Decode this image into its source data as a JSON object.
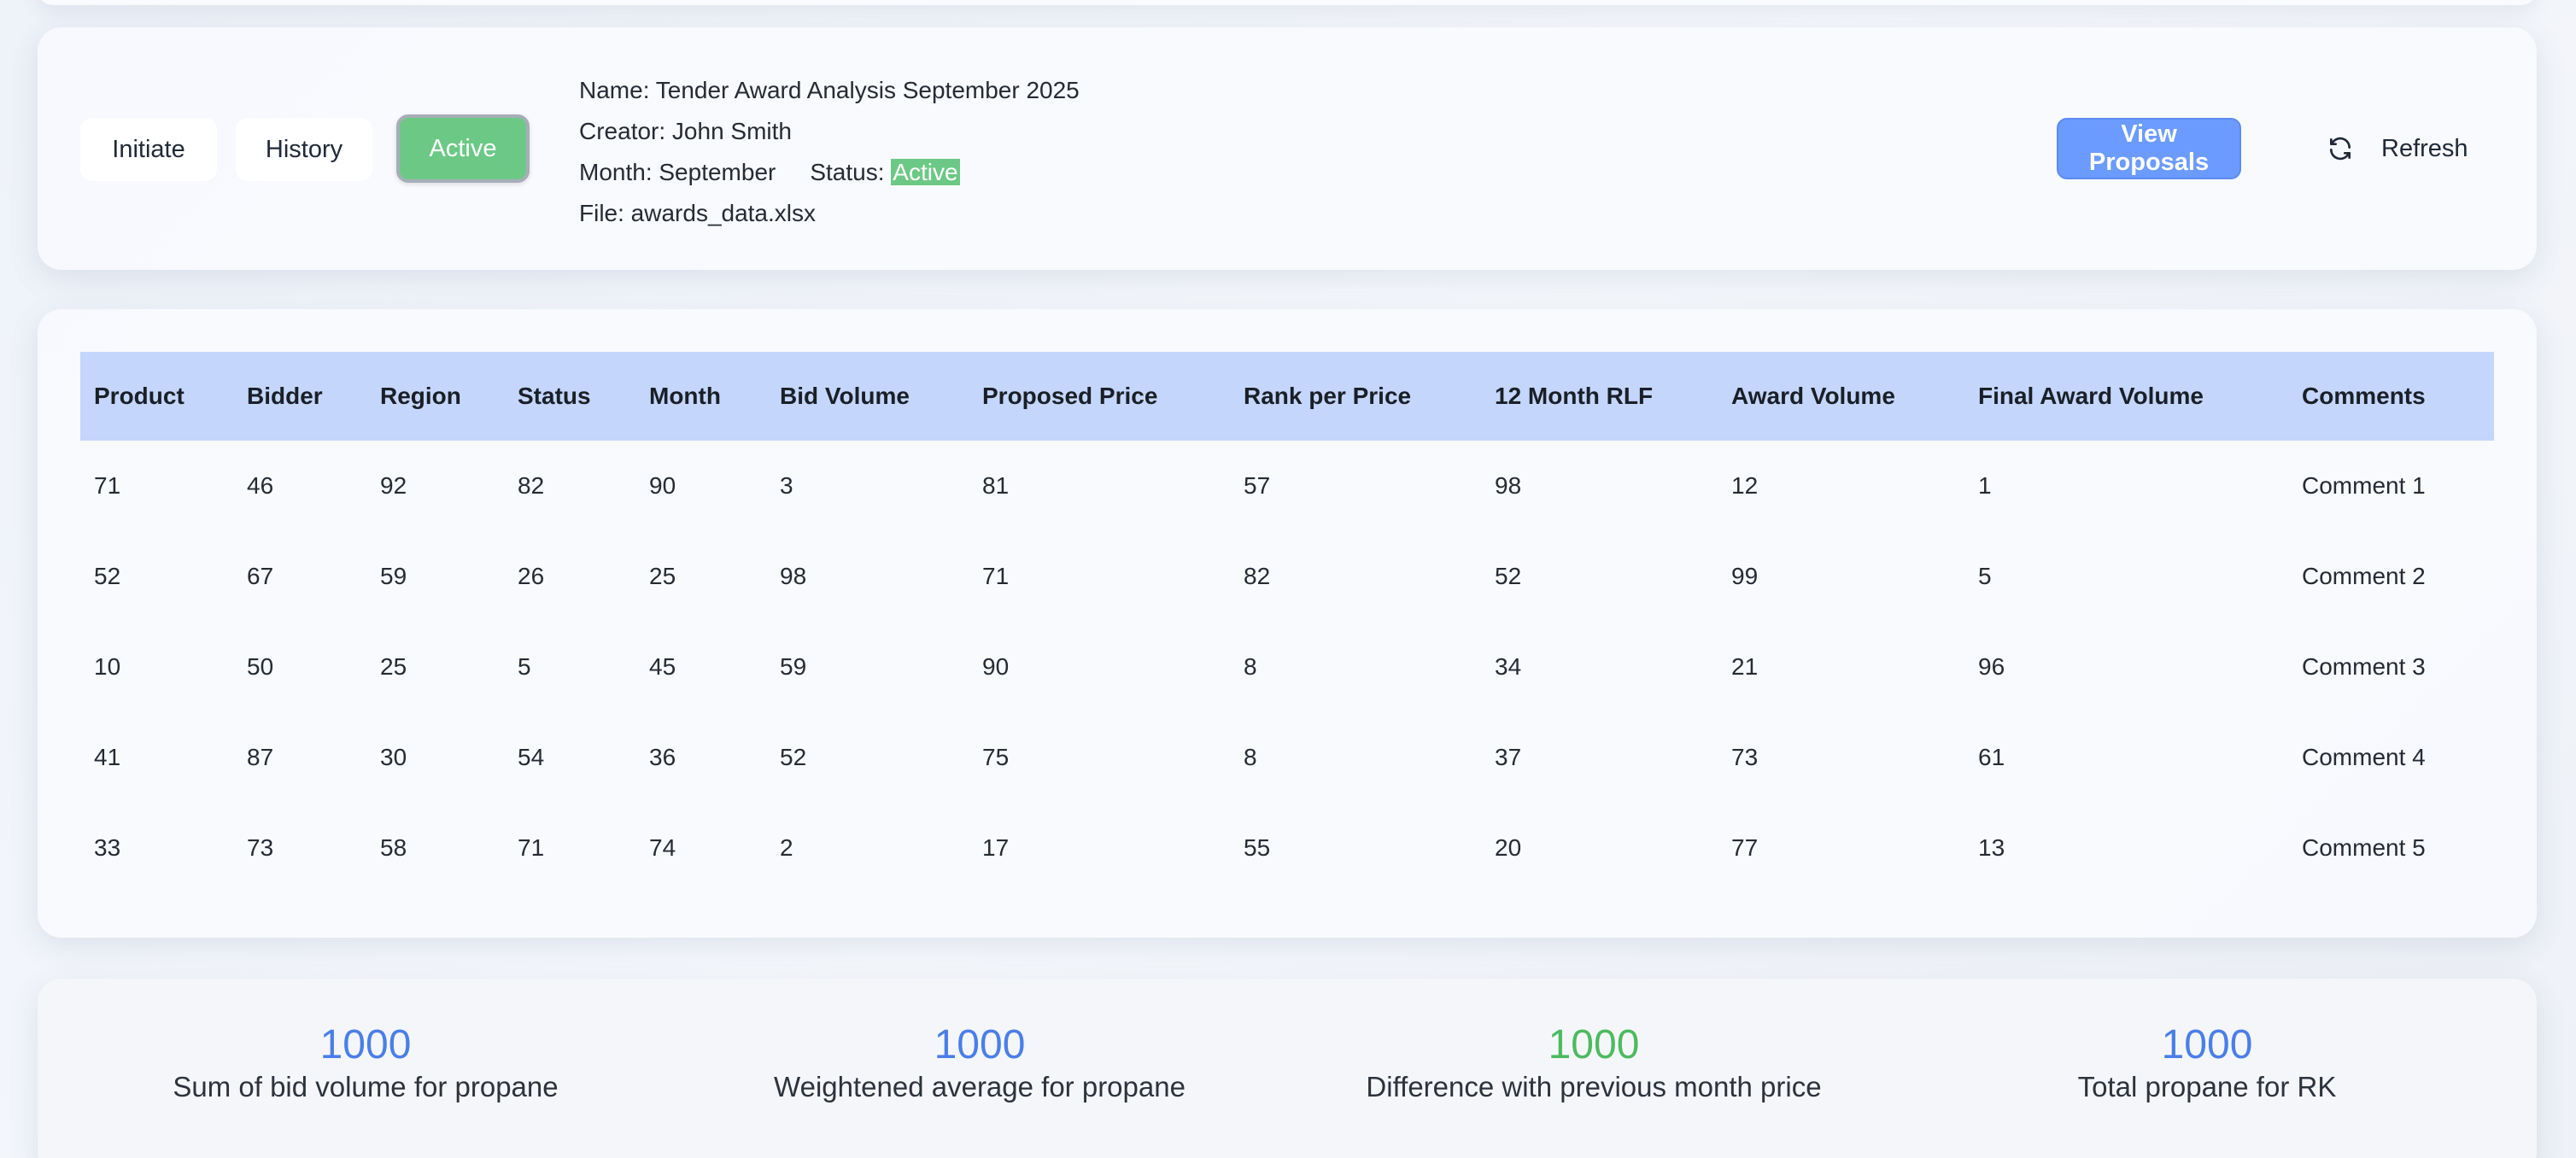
{
  "header": {
    "tabs": {
      "initiate": "Initiate",
      "history": "History",
      "active": "Active"
    },
    "name_line": "Name: Tender Award Analysis September 2025",
    "creator_line": "Creator: John Smith",
    "month_line": "Month: September",
    "status_label": "Status:",
    "status_value": "Active",
    "file_line": "File: awards_data.xlsx",
    "view_proposals": "View Proposals",
    "refresh": "Refresh",
    "accent_color": "#6b9bff",
    "active_color": "#6cc985"
  },
  "table": {
    "columns": [
      "Product",
      "Bidder",
      "Region",
      "Status",
      "Month",
      "Bid Volume",
      "Proposed Price",
      "Rank per Price",
      "12 Month RLF",
      "Award Volume",
      "Final Award Volume",
      "Comments"
    ],
    "rows": [
      [
        "71",
        "46",
        "92",
        "82",
        "90",
        "3",
        "81",
        "57",
        "98",
        "12",
        "1",
        "Comment 1"
      ],
      [
        "52",
        "67",
        "59",
        "26",
        "25",
        "98",
        "71",
        "82",
        "52",
        "99",
        "5",
        "Comment 2"
      ],
      [
        "10",
        "50",
        "25",
        "5",
        "45",
        "59",
        "90",
        "8",
        "34",
        "21",
        "96",
        "Comment 3"
      ],
      [
        "41",
        "87",
        "30",
        "54",
        "36",
        "52",
        "75",
        "8",
        "37",
        "73",
        "61",
        "Comment 4"
      ],
      [
        "33",
        "73",
        "58",
        "71",
        "74",
        "2",
        "17",
        "55",
        "20",
        "77",
        "13",
        "Comment 5"
      ]
    ]
  },
  "stats": [
    {
      "value": "1000",
      "label": "Sum of bid volume for propane",
      "color": "#4a7fe8"
    },
    {
      "value": "1000",
      "label": "Weightened average for propane",
      "color": "#4a7fe8"
    },
    {
      "value": "1000",
      "label": "Difference with previous month price",
      "color": "#4cbb5f"
    },
    {
      "value": "1000",
      "label": "Total propane for RK",
      "color": "#4a7fe8"
    }
  ]
}
